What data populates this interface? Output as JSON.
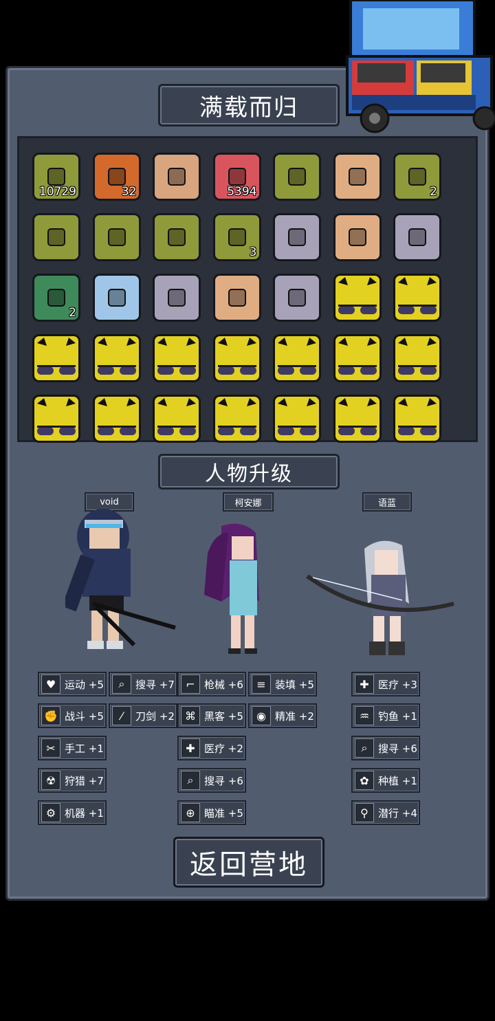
{
  "header": {
    "title": "满载而归"
  },
  "loot": {
    "items": [
      {
        "icon": "bandage-icon",
        "count": "10729",
        "bg": "#8f9a3a"
      },
      {
        "icon": "scrap-gears-icon",
        "count": "32",
        "bg": "#d36a2c"
      },
      {
        "icon": "camo-backpack-icon",
        "count": "",
        "bg": "#d9a57e"
      },
      {
        "icon": "medkit-icon",
        "count": "5394",
        "bg": "#d9555e"
      },
      {
        "icon": "chili-pepper-icon",
        "count": "",
        "bg": "#8f9a3a"
      },
      {
        "icon": "rope-icon",
        "count": "",
        "bg": "#e0ad83"
      },
      {
        "icon": "herb-leaf-icon",
        "count": "2",
        "bg": "#8f9a3a"
      },
      {
        "icon": "raw-meat-icon",
        "count": "",
        "bg": "#8f9a3a"
      },
      {
        "icon": "apple-icon",
        "count": "",
        "bg": "#8f9a3a"
      },
      {
        "icon": "milk-bottle-icon",
        "count": "",
        "bg": "#8f9a3a"
      },
      {
        "icon": "cloth-icon",
        "count": "3",
        "bg": "#8f9a3a"
      },
      {
        "icon": "throwing-knives-icon",
        "count": "",
        "bg": "#a8a2b8"
      },
      {
        "icon": "stone-icon",
        "count": "",
        "bg": "#e0ad83"
      },
      {
        "icon": "battery-icon",
        "count": "",
        "bg": "#a8a2b8"
      },
      {
        "icon": "wood-log-icon",
        "count": "2",
        "bg": "#3f8a5a"
      },
      {
        "icon": "circuit-board-icon",
        "count": "",
        "bg": "#9fc6e8"
      },
      {
        "icon": "rifle-icon",
        "count": "",
        "bg": "#a8a2b8"
      },
      {
        "icon": "sneaker-icon",
        "count": "",
        "bg": "#e0ad83"
      },
      {
        "icon": "manual-book-icon",
        "count": "",
        "bg": "#a8a2b8"
      }
    ],
    "locked_slots": 16
  },
  "upgrade": {
    "title": "人物升级"
  },
  "characters": [
    {
      "name": "void"
    },
    {
      "name": "柯安娜"
    },
    {
      "name": "语蓝"
    }
  ],
  "skills": {
    "void": [
      {
        "icon": "heart-icon",
        "glyph": "♥",
        "label": "运动 +5"
      },
      {
        "icon": "magnifier-icon",
        "glyph": "⌕",
        "label": "搜寻 +7"
      },
      {
        "icon": "gun-icon",
        "glyph": "⌐",
        "label": "枪械 +6"
      },
      {
        "icon": "ammo-icon",
        "glyph": "≡",
        "label": "装填 +5"
      },
      {
        "icon": "fist-icon",
        "glyph": "✊",
        "label": "战斗 +5"
      },
      {
        "icon": "sword-icon",
        "glyph": "⁄",
        "label": "刀剑 +2"
      },
      {
        "icon": "hacker-icon",
        "glyph": "⌘",
        "label": "黑客 +5"
      },
      {
        "icon": "eye-icon",
        "glyph": "◉",
        "label": "精准 +2"
      },
      {
        "icon": "scissors-icon",
        "glyph": "✂",
        "label": "手工 +1"
      },
      {
        "icon": "hunting-icon",
        "glyph": "☢",
        "label": "狩猎 +7"
      },
      {
        "icon": "machine-gear-icon",
        "glyph": "⚙",
        "label": "机器 +1"
      }
    ],
    "keana": [
      {
        "icon": "medical-icon",
        "glyph": "✚",
        "label": "医疗 +2"
      },
      {
        "icon": "magnifier-icon",
        "glyph": "⌕",
        "label": "搜寻 +6"
      },
      {
        "icon": "crosshair-icon",
        "glyph": "⊕",
        "label": "瞄准 +5"
      }
    ],
    "yulan": [
      {
        "icon": "medical-icon",
        "glyph": "✚",
        "label": "医疗 +3"
      },
      {
        "icon": "fishing-icon",
        "glyph": "♒",
        "label": "钓鱼 +1"
      },
      {
        "icon": "magnifier-icon",
        "glyph": "⌕",
        "label": "搜寻 +6"
      },
      {
        "icon": "plant-icon",
        "glyph": "✿",
        "label": "种植 +1"
      },
      {
        "icon": "stealth-icon",
        "glyph": "⚲",
        "label": "潜行 +4"
      }
    ]
  },
  "footer": {
    "return_label": "返回营地"
  }
}
